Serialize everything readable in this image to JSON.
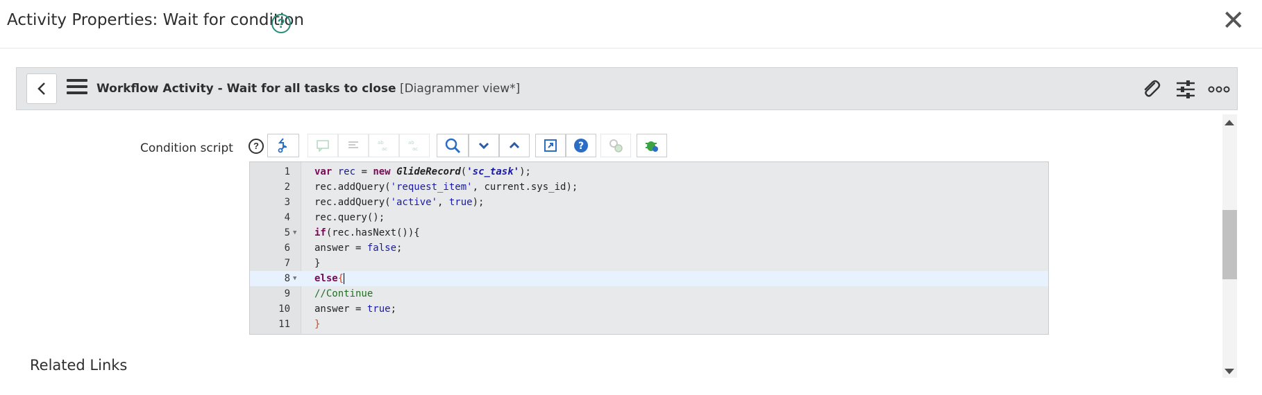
{
  "dialog": {
    "title": "Activity Properties: Wait for condition",
    "help_icon": "question-circle-icon",
    "close_icon": "close-icon"
  },
  "form_header": {
    "title_bold": "Workflow Activity - Wait for all tasks to close",
    "view_label": "[Diagrammer view*]",
    "icons": [
      "back-icon",
      "hamburger-icon",
      "paperclip-icon",
      "sliders-icon",
      "more-icon"
    ]
  },
  "field": {
    "label": "Condition script",
    "help": "?"
  },
  "code_lines": [
    {
      "num": "1",
      "text": "var rec = new GlideRecord('sc_task');"
    },
    {
      "num": "2",
      "text": "rec.addQuery('request_item', current.sys_id);"
    },
    {
      "num": "3",
      "text": "rec.addQuery('active', true);"
    },
    {
      "num": "4",
      "text": "rec.query();"
    },
    {
      "num": "5",
      "text": "if(rec.hasNext()){"
    },
    {
      "num": "6",
      "text": "answer = false;"
    },
    {
      "num": "7",
      "text": "}"
    },
    {
      "num": "8",
      "text": "else{"
    },
    {
      "num": "9",
      "text": "//Continue"
    },
    {
      "num": "10",
      "text": "answer = true;"
    },
    {
      "num": "11",
      "text": "}"
    }
  ],
  "related_links": "Related Links",
  "colors": {
    "accent_teal": "#278e7a",
    "header_bar": "#e4e6e7"
  }
}
